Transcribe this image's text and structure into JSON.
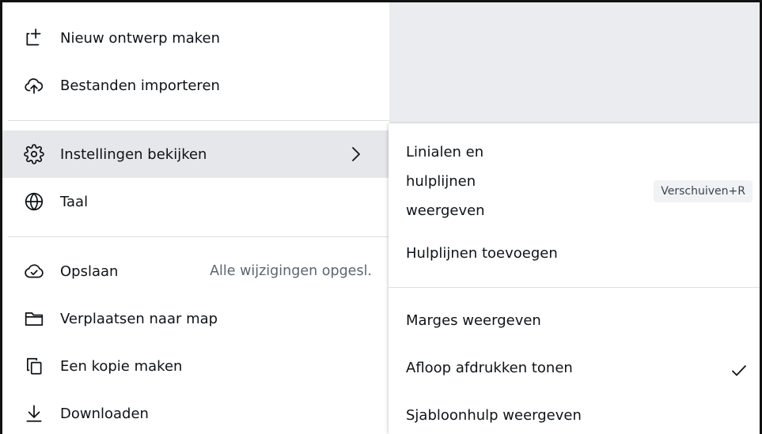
{
  "menu": {
    "items": [
      {
        "label": "Nieuw ontwerp maken",
        "icon": "new-design-icon"
      },
      {
        "label": "Bestanden importeren",
        "icon": "cloud-upload-icon"
      },
      {
        "label": "Instellingen bekijken",
        "icon": "gear-icon",
        "active": true,
        "has_submenu": true
      },
      {
        "label": "Taal",
        "icon": "globe-icon"
      },
      {
        "label": "Opslaan",
        "icon": "cloud-check-icon",
        "hint": "Alle wijzigingen opgesl."
      },
      {
        "label": "Verplaatsen naar map",
        "icon": "folder-icon"
      },
      {
        "label": "Een kopie maken",
        "icon": "copy-icon"
      },
      {
        "label": "Downloaden",
        "icon": "download-icon"
      }
    ]
  },
  "submenu": {
    "rulers": {
      "lines": [
        "Linialen en",
        "hulplijnen",
        "weergeven"
      ],
      "shortcut": "Verschuiven+R"
    },
    "add_guides": "Hulplijnen toevoegen",
    "show_margins": "Marges weergeven",
    "bleed": {
      "label": "Afloop afdrukken tonen",
      "checked": true
    },
    "template_help": "Sjabloonhulp weergeven"
  }
}
